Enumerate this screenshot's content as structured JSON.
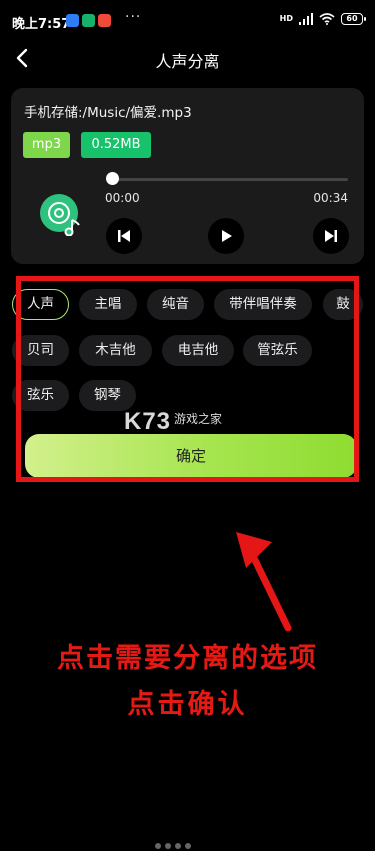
{
  "status_bar": {
    "time": "晚上7:57",
    "app_icon_colors": [
      "#2f7df6",
      "#17b26a",
      "#f04a3a"
    ],
    "more": "···",
    "network_label": "HD",
    "battery": "60"
  },
  "header": {
    "title": "人声分离",
    "back_icon": "chevron-left-icon"
  },
  "file": {
    "path": "手机存储:/Music/偏爱.mp3",
    "format": "mp3",
    "size": "0.52MB",
    "time_current": "00:00",
    "time_total": "00:34",
    "progress": 0.0
  },
  "options": [
    {
      "label": "人声",
      "selected": true
    },
    {
      "label": "主唱",
      "selected": false
    },
    {
      "label": "纯音",
      "selected": false
    },
    {
      "label": "带伴唱伴奏",
      "selected": false
    },
    {
      "label": "鼓",
      "selected": false
    },
    {
      "label": "贝司",
      "selected": false
    },
    {
      "label": "木吉他",
      "selected": false
    },
    {
      "label": "电吉他",
      "selected": false
    },
    {
      "label": "管弦乐",
      "selected": false
    },
    {
      "label": "弦乐",
      "selected": false
    },
    {
      "label": "钢琴",
      "selected": false
    }
  ],
  "confirm_label": "确定",
  "watermark": {
    "logo": "K73",
    "text": "游戏之家"
  },
  "annotation": {
    "line1": "点击需要分离的选项",
    "line2": "点击确认"
  },
  "colors": {
    "accent_green": "#8fdc31",
    "highlight_red": "#e51616",
    "chip_bg": "#1c1c1e"
  }
}
